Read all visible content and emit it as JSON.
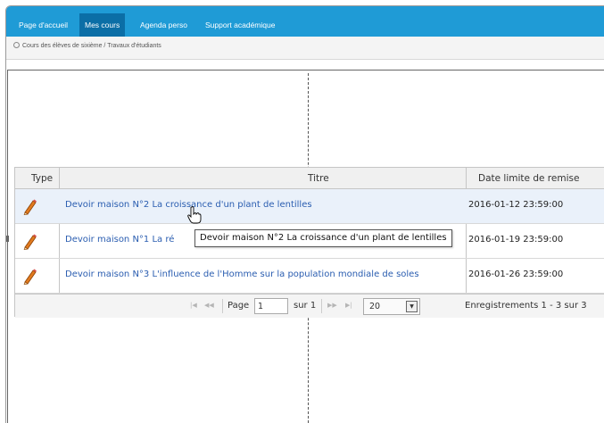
{
  "nav": {
    "items": [
      {
        "label": "Page d'accueil"
      },
      {
        "label": "Mes cours"
      },
      {
        "label": "Agenda perso"
      },
      {
        "label": "Support académique"
      }
    ]
  },
  "breadcrumb": {
    "text": "Cours des élèves de sixième / Travaux d'étudiants"
  },
  "grid": {
    "headers": {
      "type": "Type",
      "title": "Titre",
      "date": "Date limite de remise"
    },
    "rows": [
      {
        "icon": "pencil-icon",
        "title": "Devoir maison N°2 La croissance d'un plant de lentilles",
        "date": "2016-01-12 23:59:00"
      },
      {
        "icon": "pencil-icon",
        "title": "Devoir maison N°1 La ré",
        "date": "2016-01-19 23:59:00"
      },
      {
        "icon": "pencil-icon",
        "title": "Devoir maison N°3 L'influence de l'Homme sur la population mondiale de soles",
        "date": "2016-01-26 23:59:00"
      }
    ],
    "tooltip": "Devoir maison N°2 La croissance d'un plant de lentilles"
  },
  "pager": {
    "page_label": "Page",
    "page_value": "1",
    "of_label": "sur 1",
    "rows_per_page": "20",
    "records": "Enregistrements 1 - 3 sur 3"
  },
  "colors": {
    "nav_bg": "#1f9bd6",
    "nav_active": "#0b6ea6",
    "link": "#2a5db0",
    "selected_row": "#eaf1fa"
  }
}
